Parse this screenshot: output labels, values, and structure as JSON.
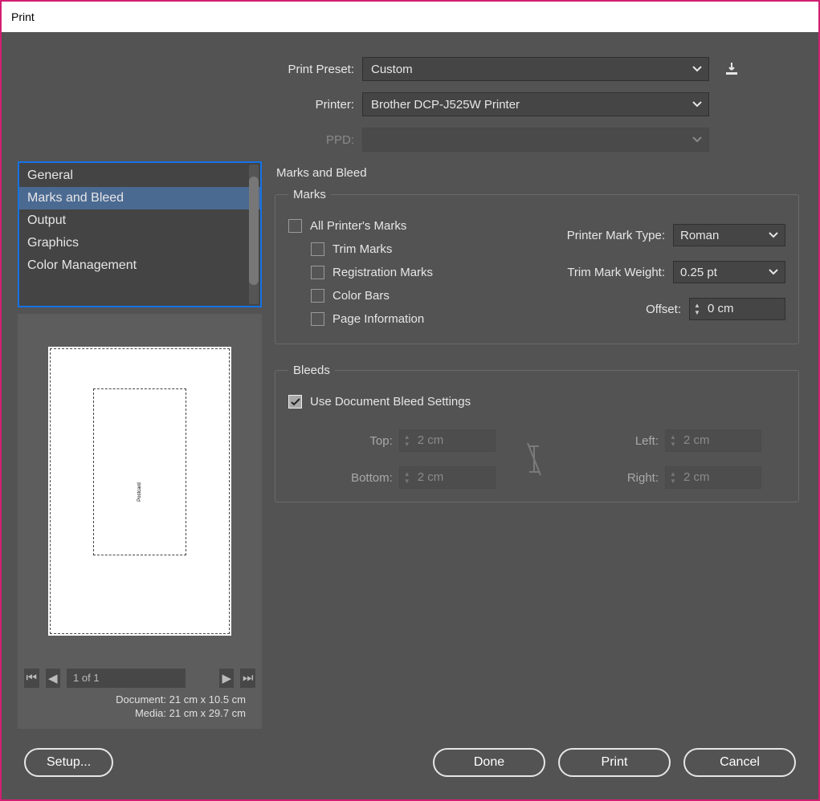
{
  "title": "Print",
  "form": {
    "preset_label": "Print Preset:",
    "preset_value": "Custom",
    "printer_label": "Printer:",
    "printer_value": "Brother DCP-J525W Printer",
    "ppd_label": "PPD:",
    "ppd_value": ""
  },
  "categories": [
    "General",
    "Marks and Bleed",
    "Output",
    "Graphics",
    "Color Management"
  ],
  "categories_selected_index": 1,
  "preview": {
    "page_indicator": "1 of 1",
    "doc_label": "Document:",
    "doc_value": "21 cm x 10.5 cm",
    "media_label": "Media:",
    "media_value": "21 cm x 29.7 cm",
    "thumbnail_text": "Postcard"
  },
  "panel": {
    "title": "Marks and Bleed",
    "marks": {
      "legend": "Marks",
      "all": "All Printer's Marks",
      "trim": "Trim Marks",
      "registration": "Registration Marks",
      "color_bars": "Color Bars",
      "page_info": "Page Information",
      "mark_type_label": "Printer Mark Type:",
      "mark_type_value": "Roman",
      "weight_label": "Trim Mark Weight:",
      "weight_value": "0.25 pt",
      "offset_label": "Offset:",
      "offset_value": "0 cm"
    },
    "bleeds": {
      "legend": "Bleeds",
      "use_doc": "Use Document Bleed Settings",
      "use_doc_checked": true,
      "top_label": "Top:",
      "top_value": "2 cm",
      "bottom_label": "Bottom:",
      "bottom_value": "2 cm",
      "left_label": "Left:",
      "left_value": "2 cm",
      "right_label": "Right:",
      "right_value": "2 cm"
    }
  },
  "buttons": {
    "setup": "Setup...",
    "done": "Done",
    "print": "Print",
    "cancel": "Cancel"
  }
}
